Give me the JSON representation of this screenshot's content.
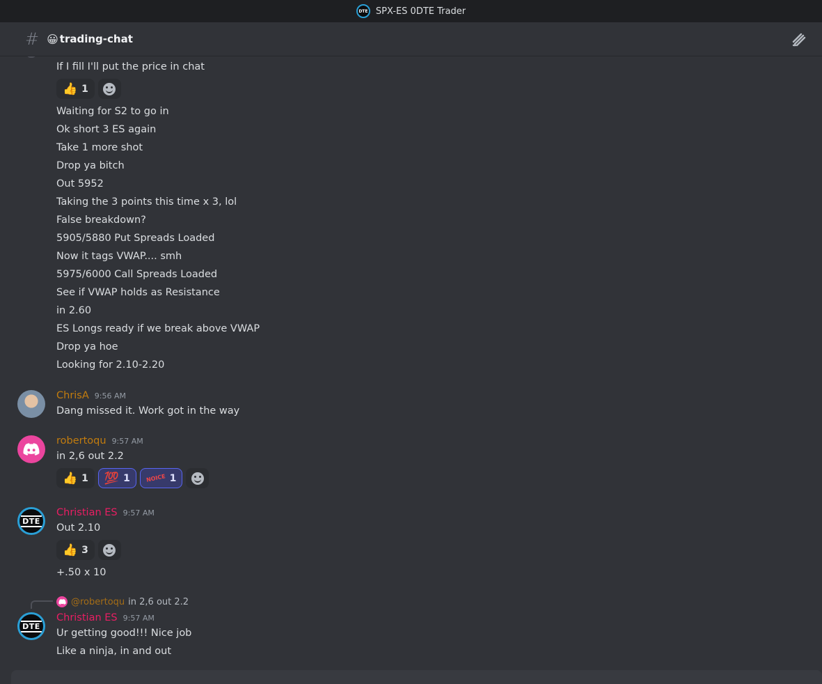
{
  "app": {
    "server_name": "SPX-ES 0DTE Trader",
    "logo_text": "DTE"
  },
  "channel": {
    "emoji": "😀",
    "name": "trading-chat"
  },
  "messages": {
    "block1": {
      "lines": [
        "If I fill I'll put the price in chat"
      ],
      "reaction_count": "1",
      "lines2": [
        "Waiting for S2 to go in",
        "Ok short 3 ES again",
        "Take 1 more shot",
        "Drop ya bitch",
        "Out 5952",
        "Taking the 3 points this time x 3, lol",
        "False breakdown?",
        "5905/5880 Put Spreads Loaded",
        "Now it tags VWAP.... smh",
        "5975/6000 Call Spreads Loaded",
        "See if VWAP holds as Resistance",
        "in 2.60",
        "ES Longs ready if we break above VWAP",
        "Drop ya hoe",
        "Looking for 2.10-2.20"
      ]
    },
    "chris": {
      "author": "ChrisA",
      "time": "9:56 AM",
      "text": "Dang missed it.  Work got in the way",
      "color": "#c27c0e"
    },
    "roberto": {
      "author": "robertoqu",
      "time": "9:57 AM",
      "text": "in 2,6 out 2.2",
      "color": "#c27c0e",
      "reactions": [
        {
          "emoji": "👍",
          "count": "1"
        },
        {
          "emoji": "💯",
          "count": "1"
        },
        {
          "emoji": "NOICE",
          "count": "1"
        }
      ]
    },
    "christian1": {
      "author": "Christian ES",
      "time": "9:57 AM",
      "text": "Out 2.10",
      "color": "#e91e63",
      "reaction_count": "3",
      "text2": "+.50 x 10"
    },
    "christian2": {
      "reply_mention": "@robertoqu",
      "reply_snippet": "in 2,6 out 2.2",
      "author": "Christian ES",
      "time": "9:57 AM",
      "lines": [
        "Ur getting good!!!  Nice job",
        "Like a ninja, in and out"
      ]
    }
  }
}
